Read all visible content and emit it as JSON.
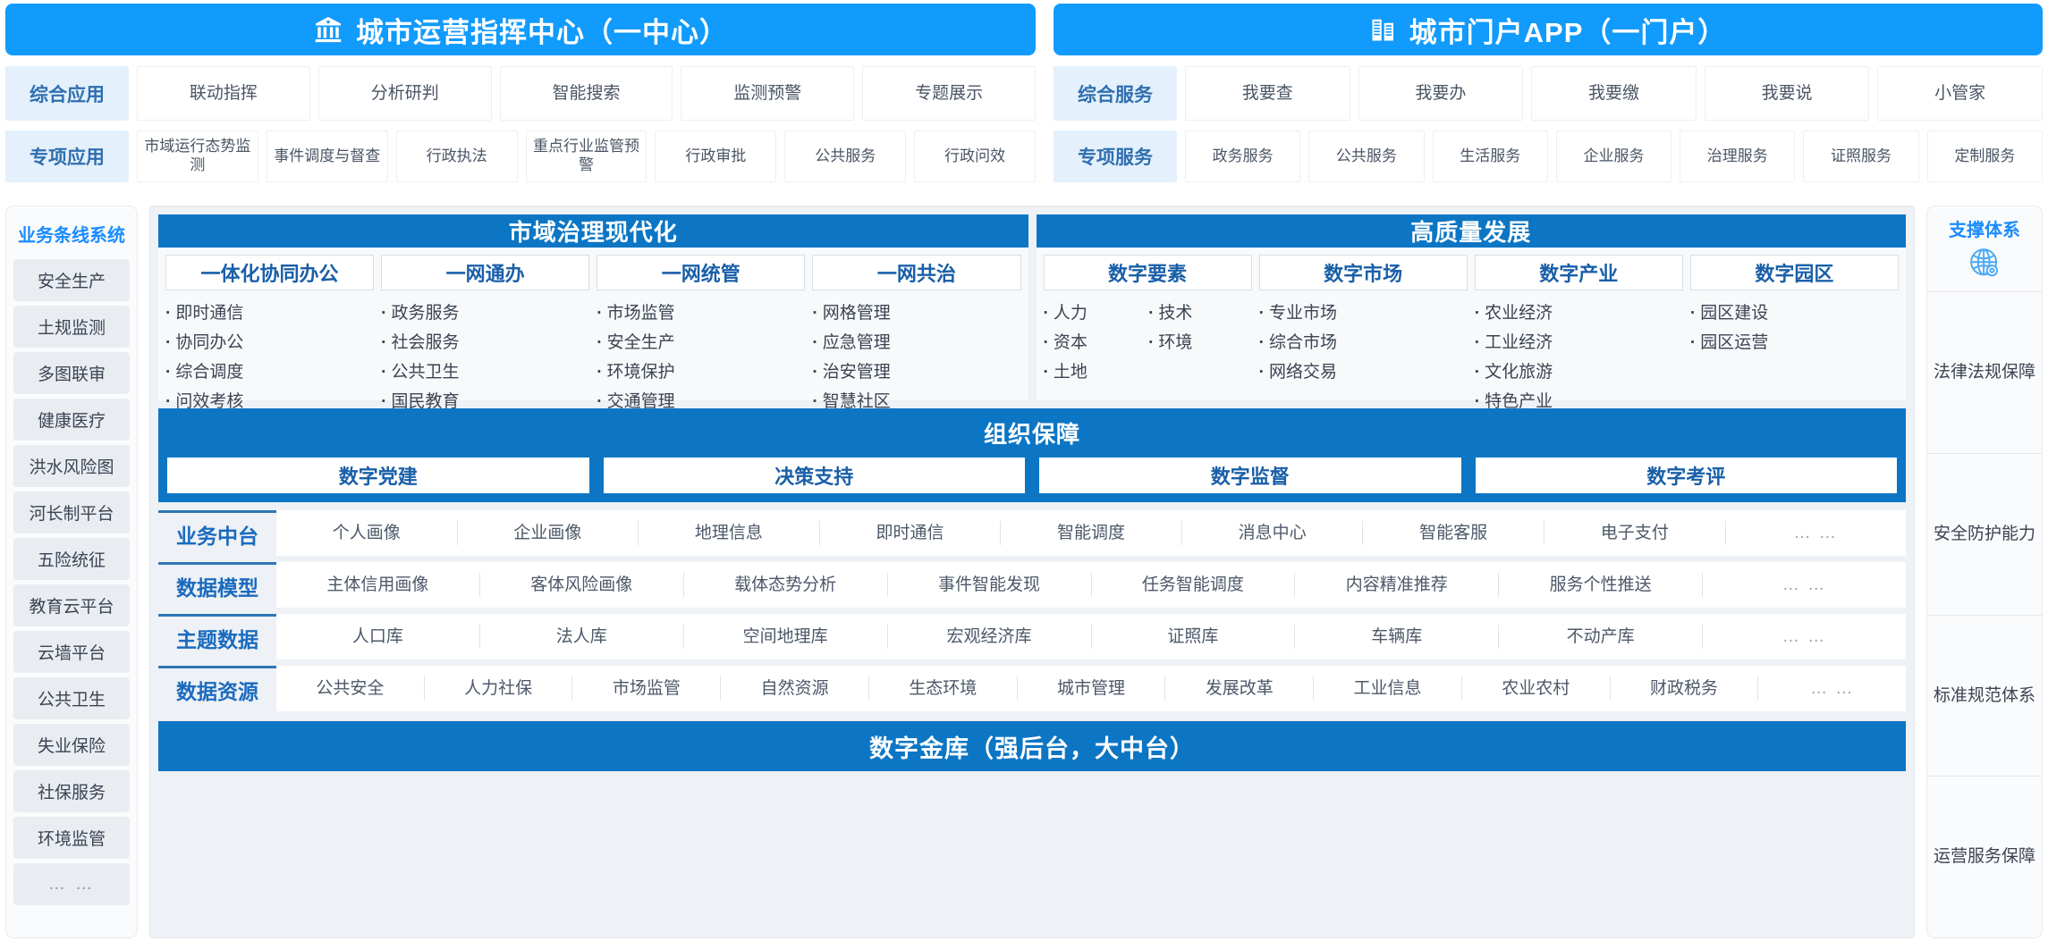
{
  "left_column": {
    "hero": {
      "icon": "bank-building-icon",
      "title": "城市运营指挥中心（一中心）"
    },
    "rows": [
      {
        "label": "综合应用",
        "items": [
          "联动指挥",
          "分析研判",
          "智能搜索",
          "监测预警",
          "专题展示"
        ]
      },
      {
        "label": "专项应用",
        "items": [
          "市域运行态势监测",
          "事件调度与督查",
          "行政执法",
          "重点行业监管预警",
          "行政审批",
          "公共服务",
          "行政问效"
        ]
      }
    ]
  },
  "right_column": {
    "hero": {
      "icon": "city-buildings-icon",
      "title": "城市门户APP（一门户）"
    },
    "rows": [
      {
        "label": "综合服务",
        "items": [
          "我要查",
          "我要办",
          "我要缴",
          "我要说",
          "小管家"
        ]
      },
      {
        "label": "专项服务",
        "items": [
          "政务服务",
          "公共服务",
          "生活服务",
          "企业服务",
          "治理服务",
          "证照服务",
          "定制服务"
        ]
      }
    ]
  },
  "left_rail": {
    "title": "业务条线系统",
    "items": [
      "安全生产",
      "土规监测",
      "多图联审",
      "健康医疗",
      "洪水风险图",
      "河长制平台",
      "五险统征",
      "教育云平台",
      "云墙平台",
      "公共卫生",
      "失业保险",
      "社保服务",
      "环境监管",
      "… …"
    ]
  },
  "right_rail": {
    "title": "支撑体系",
    "icon": "globe-gear-icon",
    "items": [
      "法律法规保障",
      "安全防护能力",
      "标准规范体系",
      "运营服务保障"
    ]
  },
  "panes": [
    {
      "title": "市域治理现代化",
      "tabs": [
        "一体化协同办公",
        "一网通办",
        "一网统管",
        "一网共治"
      ],
      "columns": [
        {
          "layout": "single",
          "items": [
            "即时通信",
            "协同办公",
            "综合调度",
            "问效考核"
          ]
        },
        {
          "layout": "single",
          "items": [
            "政务服务",
            "社会服务",
            "公共卫生",
            "国民教育"
          ]
        },
        {
          "layout": "single",
          "items": [
            "市场监管",
            "安全生产",
            "环境保护",
            "交通管理"
          ]
        },
        {
          "layout": "single",
          "items": [
            "网格管理",
            "应急管理",
            "治安管理",
            "智慧社区"
          ]
        }
      ]
    },
    {
      "title": "高质量发展",
      "tabs": [
        "数字要素",
        "数字市场",
        "数字产业",
        "数字园区"
      ],
      "columns": [
        {
          "layout": "split",
          "left": [
            "人力",
            "资本",
            "土地"
          ],
          "right": [
            "技术",
            "环境"
          ]
        },
        {
          "layout": "single",
          "items": [
            "专业市场",
            "综合市场",
            "网络交易"
          ]
        },
        {
          "layout": "single",
          "items": [
            "农业经济",
            "工业经济",
            "文化旅游",
            "特色产业"
          ]
        },
        {
          "layout": "single",
          "items": [
            "园区建设",
            "园区运营"
          ]
        }
      ]
    }
  ],
  "org": {
    "title": "组织保障",
    "items": [
      "数字党建",
      "决策支持",
      "数字监督",
      "数字考评"
    ]
  },
  "stack": [
    {
      "label": "业务中台",
      "items": [
        "个人画像",
        "企业画像",
        "地理信息",
        "即时通信",
        "智能调度",
        "消息中心",
        "智能客服",
        "电子支付",
        "… …"
      ]
    },
    {
      "label": "数据模型",
      "items": [
        "主体信用画像",
        "客体风险画像",
        "载体态势分析",
        "事件智能发现",
        "任务智能调度",
        "内容精准推荐",
        "服务个性推送",
        "… …"
      ]
    },
    {
      "label": "主题数据",
      "items": [
        "人口库",
        "法人库",
        "空间地理库",
        "宏观经济库",
        "证照库",
        "车辆库",
        "不动产库",
        "… …"
      ]
    },
    {
      "label": "数据资源",
      "items": [
        "公共安全",
        "人力社保",
        "市场监管",
        "自然资源",
        "生态环境",
        "城市管理",
        "发展改革",
        "工业信息",
        "农业农村",
        "财政税务",
        "… …"
      ]
    }
  ],
  "vault": {
    "title": "数字金库（强后台，大中台）"
  },
  "colors": {
    "hero_blue": "#119bfc",
    "section_blue": "#0c76c4",
    "label_bg": "#e4f0fb",
    "accent_text": "#1a5fa8",
    "rail_title": "#1a8cff"
  }
}
